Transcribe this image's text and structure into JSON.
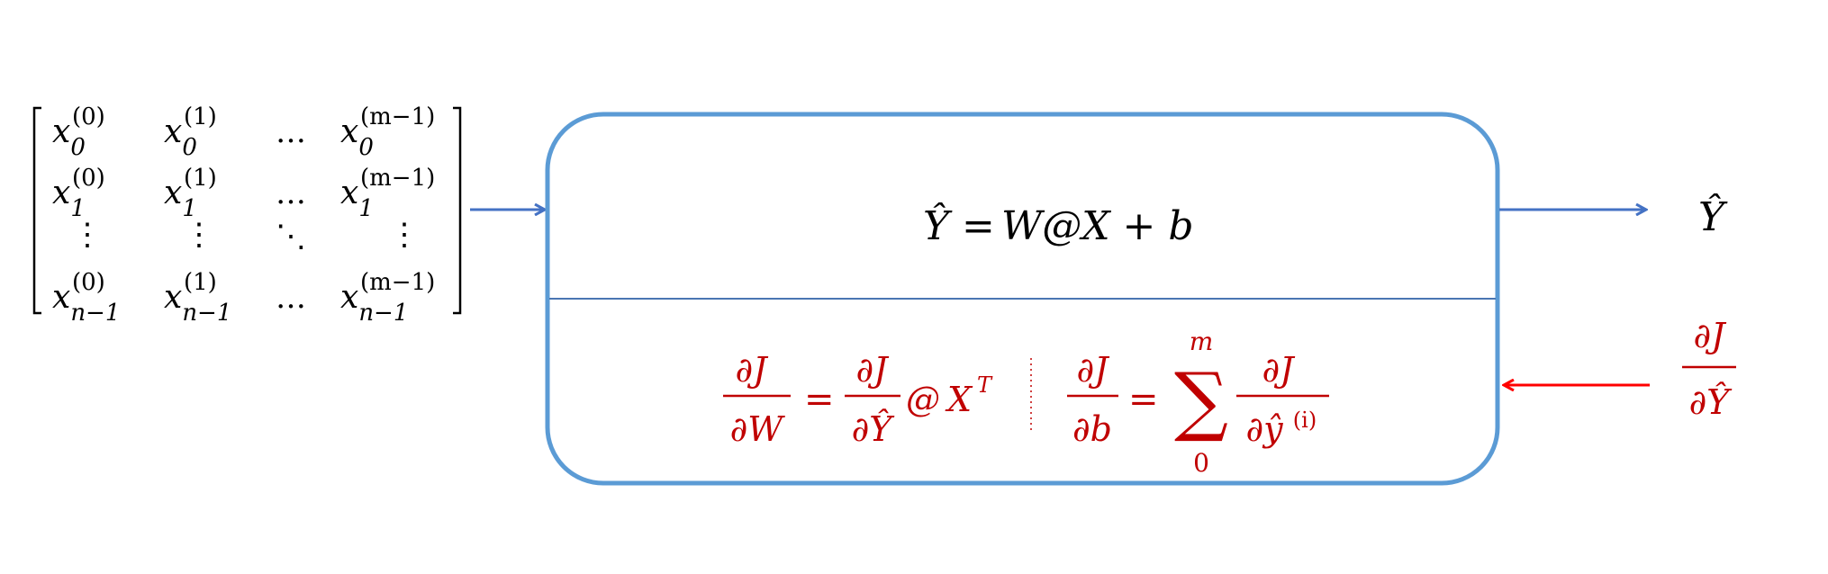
{
  "colors": {
    "box_stroke": "#5B9BD5",
    "forward_arrow": "#4472C4",
    "backward_arrow": "#FF0000",
    "backward_text": "#C00000",
    "text": "#000000"
  },
  "matrix": {
    "rows": [
      [
        {
          "base": "x",
          "sub": "0",
          "sup": "(0)"
        },
        {
          "base": "x",
          "sub": "0",
          "sup": "(1)"
        },
        {
          "base": "…",
          "sub": "",
          "sup": ""
        },
        {
          "base": "x",
          "sub": "0",
          "sup": "(m−1)"
        }
      ],
      [
        {
          "base": "x",
          "sub": "1",
          "sup": "(0)"
        },
        {
          "base": "x",
          "sub": "1",
          "sup": "(1)"
        },
        {
          "base": "…",
          "sub": "",
          "sup": ""
        },
        {
          "base": "x",
          "sub": "1",
          "sup": "(m−1)"
        }
      ],
      [
        {
          "base": "⋮",
          "sub": "",
          "sup": ""
        },
        {
          "base": "⋮",
          "sub": "",
          "sup": ""
        },
        {
          "base": "⋱",
          "sub": "",
          "sup": ""
        },
        {
          "base": "⋮",
          "sub": "",
          "sup": ""
        }
      ],
      [
        {
          "base": "x",
          "sub": "n−1",
          "sup": "(0)"
        },
        {
          "base": "x",
          "sub": "n−1",
          "sup": "(1)"
        },
        {
          "base": "…",
          "sub": "",
          "sup": ""
        },
        {
          "base": "x",
          "sub": "n−1",
          "sup": "(m−1)"
        }
      ]
    ]
  },
  "forward": {
    "y_hat": "Ŷ",
    "equals": "=",
    "rhs": "W@X + b"
  },
  "backward": {
    "partial": "∂",
    "J": "J",
    "W": "W",
    "b": "b",
    "y_hat": "Ŷ",
    "y_hat_lower": "ŷ",
    "at": "@",
    "X": "X",
    "T": "T",
    "equals": "=",
    "sum": "∑",
    "sum_upper": "m",
    "sum_lower": "0",
    "sample_index": "(i)"
  },
  "output": {
    "label": "Ŷ"
  },
  "gradient_input": {
    "numerator": "∂J",
    "denominator": "∂Ŷ"
  }
}
